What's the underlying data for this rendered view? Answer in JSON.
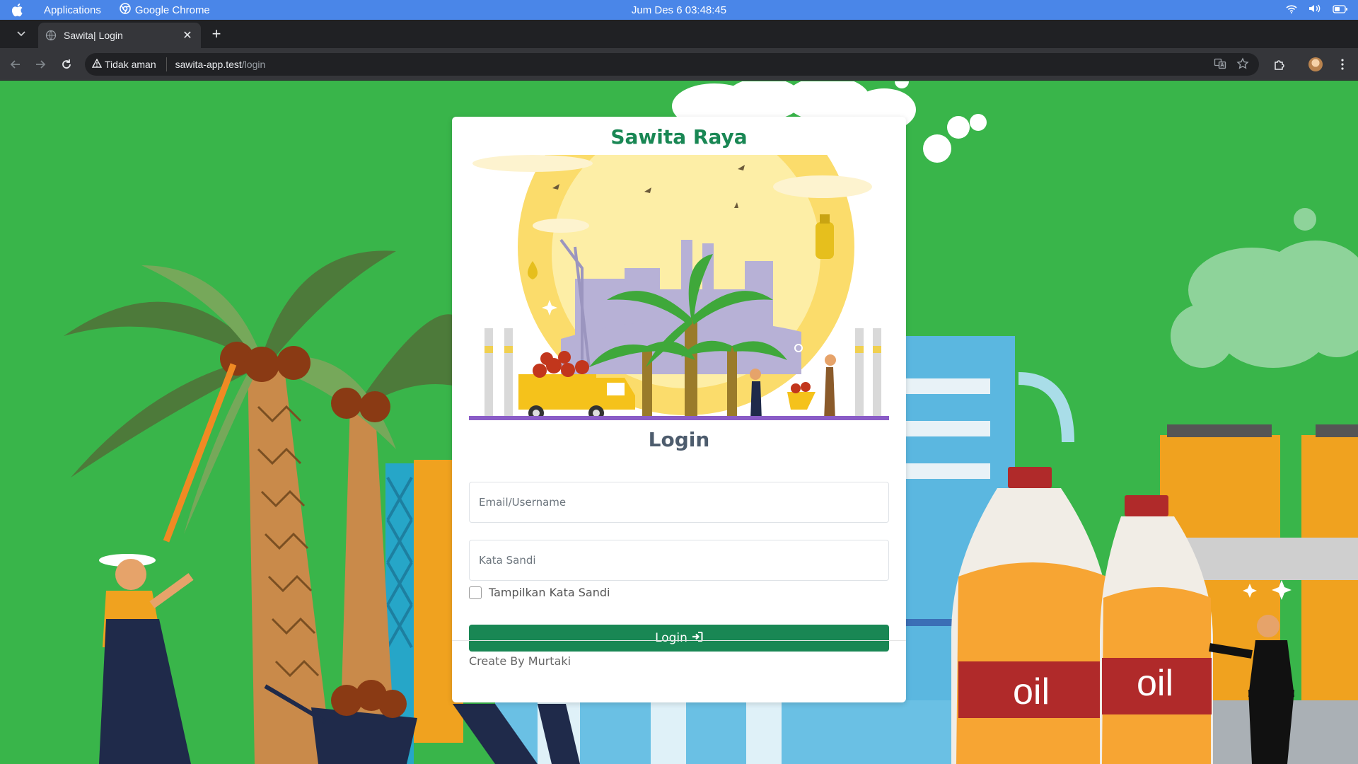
{
  "menubar": {
    "apple_icon": "apple-icon",
    "applications_label": "Applications",
    "chrome_label": "Google Chrome",
    "clock": "Jum Des 6  03:48:45"
  },
  "tab": {
    "title": "Sawita| Login"
  },
  "address_bar": {
    "security_label": "Tidak aman",
    "url_host": "sawita-app.test",
    "url_path": "/login"
  },
  "card": {
    "brand": "Sawita Raya",
    "heading": "Login",
    "email_placeholder": "Email/Username",
    "password_placeholder": "Kata Sandi",
    "show_password_label": "Tampilkan Kata Sandi",
    "login_button_label": "Login",
    "footer": "Create By Murtaki"
  },
  "illustration_text": {
    "bottle_label": "oil"
  },
  "colors": {
    "page_green": "#39b54a",
    "brand_green": "#198754",
    "menubar_blue": "#4a86e8"
  }
}
